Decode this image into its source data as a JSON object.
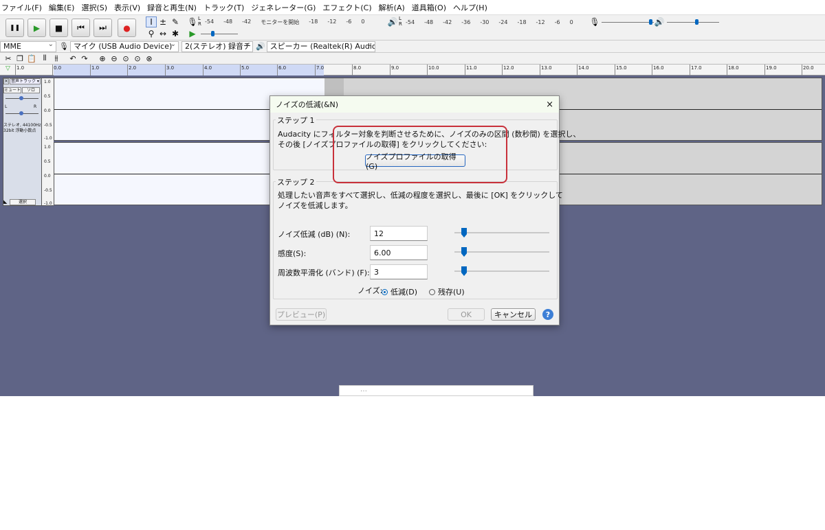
{
  "menu": [
    "ファイル(F)",
    "編集(E)",
    "選択(S)",
    "表示(V)",
    "録音と再生(N)",
    "トラック(T)",
    "ジェネレーター(G)",
    "エフェクト(C)",
    "解析(A)",
    "道具箱(O)",
    "ヘルプ(H)"
  ],
  "transport": {
    "pause": "❚❚",
    "play": "▶",
    "stop": "■",
    "skip_start": "⏮",
    "skip_end": "⏭",
    "record": "●"
  },
  "record_meter": {
    "ticks": [
      "-54",
      "-48",
      "-42",
      "モニターを開始",
      "-18",
      "-12",
      "-6",
      "0"
    ]
  },
  "play_meter": {
    "ticks": [
      "-54",
      "-48",
      "-42",
      "-36",
      "-30",
      "-24",
      "-18",
      "-12",
      "-6",
      "0"
    ]
  },
  "lr": "L\nR",
  "device": {
    "host": "MME",
    "mic": "マイク (USB Audio Device)",
    "channels": "2(ステレオ) 録音チ",
    "speaker": "スピーカー (Realtek(R) Audio)"
  },
  "ruler": {
    "ticks": [
      "1.0",
      "0.0",
      "1.0",
      "2.0",
      "3.0",
      "4.0",
      "5.0",
      "6.0",
      "7.0",
      "8.0",
      "9.0",
      "10.0",
      "11.0",
      "12.0",
      "13.0",
      "14.0",
      "15.0",
      "16.0",
      "17.0",
      "18.0",
      "19.0",
      "20.0"
    ]
  },
  "track": {
    "name": "音声トラック",
    "mute": "ミュート",
    "solo": "ソロ",
    "pan_l": "L",
    "pan_r": "R",
    "info1": "ステレオ, 44100Hz",
    "info2": "32bit 浮動小数点",
    "select": "選択",
    "scale": [
      "1.0",
      "0.5",
      "0.0",
      "-0.5",
      "-1.0",
      "1.0",
      "0.5",
      "0.0",
      "-0.5",
      "-1.0"
    ]
  },
  "popup_text": "…",
  "dialog": {
    "title": "ノイズの低減(&N)",
    "close": "×",
    "step1_label": "ステップ 1",
    "step1_line1": "Audacity にフィルター対象を判断させるために、ノイズのみの区間 (数秒間) を選択し、",
    "step1_line2": "その後 [ノイズプロファイルの取得] をクリックしてください:",
    "get_profile_button": "ノイズプロファイルの取得(G)",
    "step2_label": "ステップ 2",
    "step2_line1": "処理したい音声をすべて選択し、低減の程度を選択し、最後に [OK] をクリックして",
    "step2_line2": "ノイズを低減します。",
    "params": [
      {
        "label": "ノイズ低減 (dB) (N):",
        "value": "12"
      },
      {
        "label": "感度(S):",
        "value": "6.00"
      },
      {
        "label": "周波数平滑化 (バンド) (F):",
        "value": "3"
      }
    ],
    "noise_label": "ノイズ:",
    "radio_reduce": "低減(D)",
    "radio_residue": "残存(U)",
    "preview": "プレビュー(P)",
    "ok": "OK",
    "cancel": "キャンセル",
    "help": "?"
  }
}
